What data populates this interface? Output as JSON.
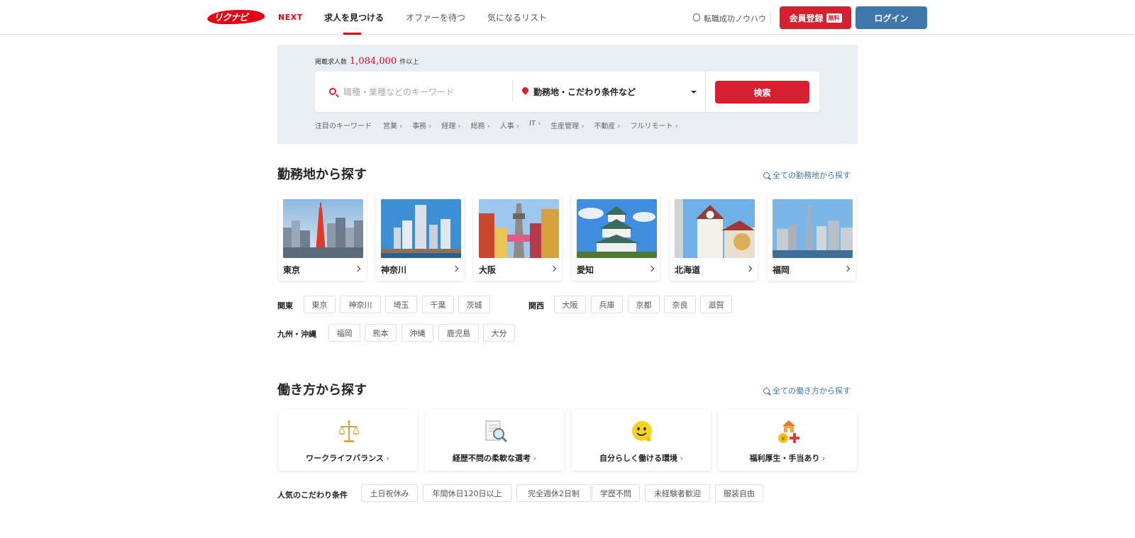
{
  "header": {
    "logo_kana": "リクナビ",
    "logo_next": "NEXT",
    "nav": [
      "求人を見つける",
      "オファーを待つ",
      "気になるリスト"
    ],
    "knowhow": "転職成功ノウハウ",
    "register": "会員登録",
    "free_badge": "無料",
    "login": "ログイン"
  },
  "search": {
    "count_label": "掲載求人数",
    "count": "1,084,000",
    "count_suffix": "件以上",
    "keyword_placeholder": "職種・業種などのキーワード",
    "location": "勤務地・こだわり条件など",
    "button": "検索",
    "kw_label": "注目のキーワード",
    "keywords": [
      "営業",
      "事務",
      "経理",
      "総務",
      "人事",
      "IT",
      "生産管理",
      "不動産",
      "フルリモート"
    ]
  },
  "location_section": {
    "title": "勤務地から探す",
    "link": "全ての勤務地から探す",
    "cities": [
      "東京",
      "神奈川",
      "大阪",
      "愛知",
      "北海道",
      "福岡"
    ],
    "regions": [
      {
        "label": "関東",
        "items": [
          "東京",
          "神奈川",
          "埼玉",
          "千葉",
          "茨城"
        ]
      },
      {
        "label": "関西",
        "items": [
          "大阪",
          "兵庫",
          "京都",
          "奈良",
          "滋賀"
        ]
      },
      {
        "label": "九州・沖縄",
        "items": [
          "福岡",
          "熊本",
          "沖縄",
          "鹿児島",
          "大分"
        ]
      }
    ]
  },
  "workstyle_section": {
    "title": "働き方から探す",
    "link": "全ての働き方から探す",
    "cards": [
      "ワークライフバランス",
      "経歴不問の柔軟な選考",
      "自分らしく働ける環境",
      "福利厚生・手当あり"
    ],
    "popular_label": "人気のこだわり条件",
    "popular": [
      "土日祝休み",
      "年間休日120日以上",
      "完全週休2日制",
      "学歴不問",
      "未経験者歓迎",
      "服装自由"
    ]
  },
  "colors": {
    "brand_red": "#d7202f",
    "brand_blue": "#3e78aa",
    "panel_bg": "#e9eef5"
  }
}
